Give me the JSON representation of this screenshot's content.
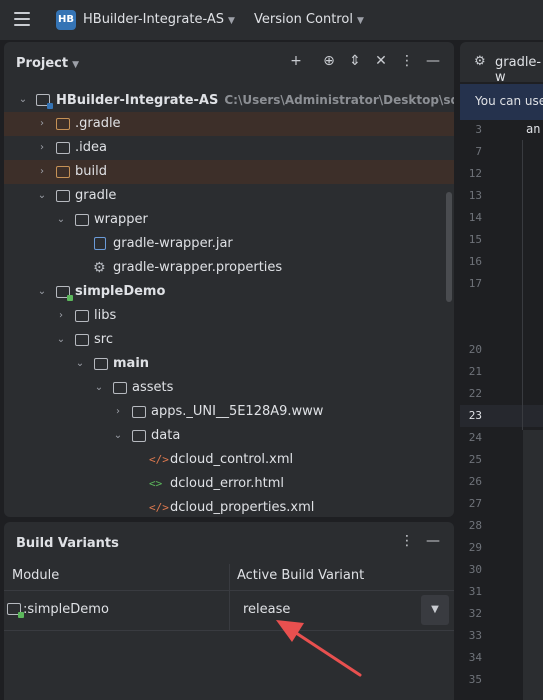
{
  "titlebar": {
    "app_badge": "HB",
    "project_name": "HBuilder-Integrate-AS",
    "vcs_label": "Version Control"
  },
  "project_panel": {
    "title": "Project",
    "tree": [
      {
        "label": "HBuilder-Integrate-AS",
        "path": "C:\\Users\\Administrator\\Desktop\\sdk\\Android",
        "bold": true,
        "expanded": true
      },
      {
        "label": ".gradle",
        "expanded": false
      },
      {
        "label": ".idea",
        "expanded": false
      },
      {
        "label": "build",
        "expanded": false
      },
      {
        "label": "gradle",
        "expanded": true
      },
      {
        "label": "wrapper",
        "expanded": true
      },
      {
        "label": "gradle-wrapper.jar"
      },
      {
        "label": "gradle-wrapper.properties"
      },
      {
        "label": "simpleDemo",
        "bold": true,
        "expanded": true
      },
      {
        "label": "libs",
        "expanded": false
      },
      {
        "label": "src",
        "expanded": true
      },
      {
        "label": "main",
        "bold": true,
        "expanded": true
      },
      {
        "label": "assets",
        "expanded": true
      },
      {
        "label": "apps._UNI__5E128A9.www",
        "expanded": false
      },
      {
        "label": "data",
        "expanded": true
      },
      {
        "label": "dcloud_control.xml"
      },
      {
        "label": "dcloud_error.html"
      },
      {
        "label": "dcloud_properties.xml"
      }
    ]
  },
  "build_variants": {
    "title": "Build Variants",
    "col_module": "Module",
    "col_variant": "Active Build Variant",
    "rows": [
      {
        "module": ":simpleDemo",
        "variant": "release"
      }
    ]
  },
  "editor": {
    "tab_name": "gradle-w",
    "banner_text": "You can use",
    "code_text": "an",
    "line_numbers": [
      "3",
      "7",
      "12",
      "13",
      "14",
      "15",
      "16",
      "17",
      "20",
      "21",
      "22",
      "23",
      "24",
      "25",
      "26",
      "27",
      "28",
      "29",
      "30",
      "31",
      "32",
      "33",
      "34",
      "35"
    ],
    "current_line": "23"
  },
  "colors": {
    "background": "#1e1f22",
    "panel": "#2b2d30",
    "excluded_folder": "#c59156",
    "highlight_row": "#3d2f29",
    "banner": "#25324d",
    "accent_arrow": "#e8504f"
  },
  "icons": [
    "menu-icon",
    "chevron-down-icon",
    "add-icon",
    "locate-icon",
    "expand-icon",
    "collapse-icon",
    "more-icon",
    "minimize-icon",
    "folder-icon",
    "file-icon",
    "jar-icon",
    "gear-icon",
    "xml-icon",
    "html-icon",
    "module-icon",
    "arrow-annotation"
  ]
}
